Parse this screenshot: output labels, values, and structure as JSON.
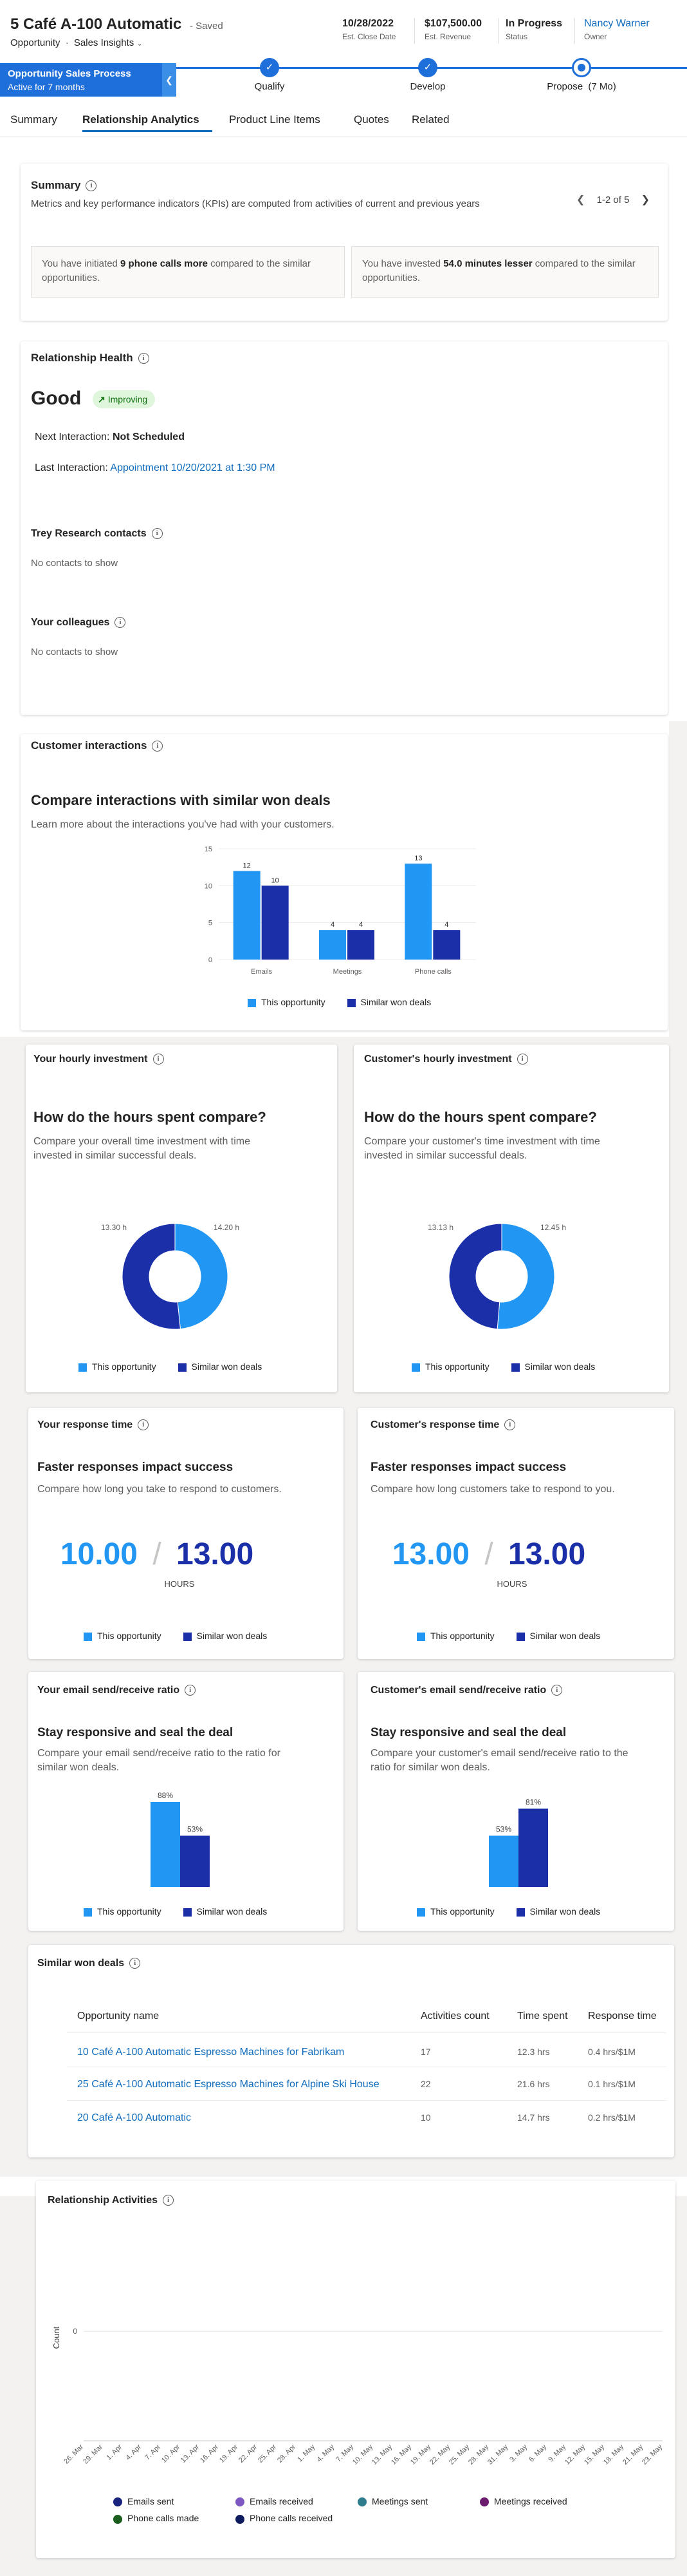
{
  "header": {
    "title": "5 Café A-100 Automatic",
    "saved": "- Saved",
    "entity": "Opportunity",
    "sep": "·",
    "form": "Sales Insights",
    "close_date": "10/28/2022",
    "close_date_label": "Est. Close Date",
    "revenue": "$107,500.00",
    "revenue_label": "Est. Revenue",
    "status": "In Progress",
    "status_label": "Status",
    "owner": "Nancy Warner",
    "owner_label": "Owner"
  },
  "process": {
    "name": "Opportunity Sales Process",
    "active": "Active for 7 months",
    "stages": [
      "Qualify",
      "Develop",
      "Propose  (7 Mo)"
    ]
  },
  "tabs": [
    "Summary",
    "Relationship Analytics",
    "Product Line Items",
    "Quotes",
    "Related"
  ],
  "summary": {
    "title": "Summary",
    "desc": "Metrics and key performance indicators (KPIs) are computed from activities of current and previous years",
    "pager": "1-2 of 5",
    "insight1_a": "You have initiated ",
    "insight1_b": "9 phone calls more",
    "insight1_c": " compared to the similar opportunities.",
    "insight2_a": "You have invested ",
    "insight2_b": "54.0 minutes lesser",
    "insight2_c": " compared to the similar opportunities."
  },
  "health": {
    "title": "Relationship Health",
    "status": "Good",
    "badge": "Improving",
    "next_label": "Next Interaction: ",
    "next_value": "Not Scheduled",
    "last_label": "Last Interaction: ",
    "last_value": "Appointment 10/20/2021 at 1:30 PM",
    "contacts_title": "Trey Research contacts",
    "contacts_empty": "No contacts to show",
    "colleagues_title": "Your colleagues",
    "colleagues_empty": "No contacts to show"
  },
  "interactions": {
    "title": "Customer interactions",
    "heading": "Compare interactions with similar won deals",
    "desc": "Learn more about the interactions you've had with your customers."
  },
  "legend": {
    "this": "This opportunity",
    "similar": "Similar won deals"
  },
  "colors": {
    "this": "#2196f3",
    "similar": "#1a2fa8",
    "accent": "#0f6cbd",
    "process": "#1e6fd9"
  },
  "hourly": {
    "title": "Your hourly investment",
    "heading": "How do the hours spent compare?",
    "desc": "Compare your overall time investment with time invested in similar successful deals."
  },
  "cust_hourly": {
    "title": "Customer's hourly investment",
    "heading": "How do the hours spent compare?",
    "desc": "Compare your customer's time investment with time invested in similar successful deals."
  },
  "response": {
    "title": "Your response time",
    "heading": "Faster responses impact success",
    "desc": "Compare how long you take to respond to customers.",
    "this": "10.00",
    "slash": "/",
    "similar": "13.00",
    "unit": "HOURS"
  },
  "cust_response": {
    "title": "Customer's response time",
    "heading": "Faster responses impact success",
    "desc": "Compare how long customers take to respond to you.",
    "this": "13.00",
    "slash": "/",
    "similar": "13.00",
    "unit": "HOURS"
  },
  "email": {
    "title": "Your email send/receive ratio",
    "heading": "Stay responsive and seal the deal",
    "desc": "Compare your email send/receive ratio to the ratio for similar won deals."
  },
  "cust_email": {
    "title": "Customer's email send/receive ratio",
    "heading": "Stay responsive and seal the deal",
    "desc": "Compare your customer's email send/receive ratio to the ratio for similar won deals."
  },
  "similar": {
    "title": "Similar won deals",
    "columns": [
      "Opportunity name",
      "Activities count",
      "Time spent",
      "Response time"
    ],
    "rows": [
      [
        "10 Café A-100 Automatic Espresso Machines for Fabrikam",
        "17",
        "12.3 hrs",
        "0.4 hrs/$1M"
      ],
      [
        "25 Café A-100 Automatic Espresso Machines for Alpine Ski House",
        "22",
        "21.6 hrs",
        "0.1 hrs/$1M"
      ],
      [
        "20 Café A-100 Automatic",
        "10",
        "14.7 hrs",
        "0.2 hrs/$1M"
      ]
    ]
  },
  "activities": {
    "title": "Relationship Activities",
    "ylabel": "Count",
    "legend": [
      "Emails sent",
      "Emails received",
      "Meetings sent",
      "Meetings received",
      "Phone calls made",
      "Phone calls received"
    ],
    "legend_colors": [
      "#1a237e",
      "#7e57c2",
      "#2e7d8c",
      "#6a1b6e",
      "#1b5e20",
      "#0d1b5e"
    ]
  },
  "chart_data": [
    {
      "type": "bar",
      "categories": [
        "Emails",
        "Meetings",
        "Phone calls"
      ],
      "series": [
        {
          "name": "This opportunity",
          "values": [
            12,
            4,
            13
          ]
        },
        {
          "name": "Similar won deals",
          "values": [
            10,
            4,
            4
          ]
        }
      ],
      "ylim": [
        0,
        15
      ],
      "yticks": [
        0,
        5,
        10,
        15
      ],
      "legend": "bottom"
    },
    {
      "type": "pie",
      "labels": [
        "This opportunity",
        "Similar won deals"
      ],
      "values": [
        13.3,
        14.2
      ],
      "value_labels": [
        "13.30 h",
        "14.20 h"
      ],
      "legend": "bottom"
    },
    {
      "type": "pie",
      "labels": [
        "This opportunity",
        "Similar won deals"
      ],
      "values": [
        13.13,
        12.45
      ],
      "value_labels": [
        "13.13 h",
        "12.45 h"
      ],
      "legend": "bottom"
    },
    {
      "type": "bar",
      "categories": [
        "Email ratio"
      ],
      "series": [
        {
          "name": "This opportunity",
          "values": [
            88
          ]
        },
        {
          "name": "Similar won deals",
          "values": [
            53
          ]
        }
      ],
      "value_labels": [
        "88%",
        "53%"
      ],
      "legend": "bottom"
    },
    {
      "type": "bar",
      "categories": [
        "Email ratio"
      ],
      "series": [
        {
          "name": "This opportunity",
          "values": [
            53
          ]
        },
        {
          "name": "Similar won deals",
          "values": [
            81
          ]
        }
      ],
      "value_labels": [
        "53%",
        "81%"
      ],
      "legend": "bottom"
    },
    {
      "type": "scatter",
      "ylabel": "Count",
      "yticks": [
        "0"
      ],
      "x": [
        "26. Mar",
        "29. Mar",
        "1. Apr",
        "4. Apr",
        "7. Apr",
        "10. Apr",
        "13. Apr",
        "16. Apr",
        "19. Apr",
        "22. Apr",
        "25. Apr",
        "28. Apr",
        "1. May",
        "4. May",
        "7. May",
        "10. May",
        "13. May",
        "16. May",
        "19. May",
        "22. May",
        "25. May",
        "28. May",
        "31. May",
        "3. May",
        "6. May",
        "9. May",
        "12. May",
        "15. May",
        "18. May",
        "21. May",
        "23. May"
      ],
      "series": [
        {
          "name": "Emails sent",
          "values": []
        },
        {
          "name": "Emails received",
          "values": []
        },
        {
          "name": "Meetings sent",
          "values": []
        },
        {
          "name": "Meetings received",
          "values": []
        },
        {
          "name": "Phone calls made",
          "values": []
        },
        {
          "name": "Phone calls received",
          "values": []
        }
      ],
      "legend": "bottom"
    }
  ]
}
